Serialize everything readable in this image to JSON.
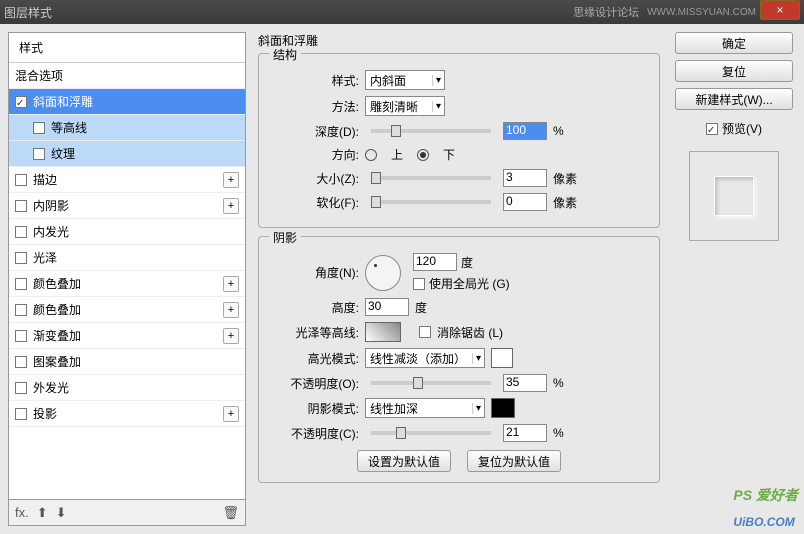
{
  "titlebar": {
    "title": "图层样式",
    "brand": "思缘设计论坛",
    "url": "WWW.MISSYUAN.COM",
    "close": "×"
  },
  "styles_list": {
    "header": "样式",
    "blend_options": "混合选项",
    "items": [
      {
        "label": "斜面和浮雕",
        "checked": true,
        "selected": true,
        "has_plus": false
      },
      {
        "label": "等高线",
        "checked": false,
        "sub": true
      },
      {
        "label": "纹理",
        "checked": false,
        "sub": true
      },
      {
        "label": "描边",
        "checked": false,
        "has_plus": true
      },
      {
        "label": "内阴影",
        "checked": false,
        "has_plus": true
      },
      {
        "label": "内发光",
        "checked": false
      },
      {
        "label": "光泽",
        "checked": false
      },
      {
        "label": "颜色叠加",
        "checked": false,
        "has_plus": true
      },
      {
        "label": "颜色叠加",
        "checked": false,
        "has_plus": true
      },
      {
        "label": "渐变叠加",
        "checked": false,
        "has_plus": true
      },
      {
        "label": "图案叠加",
        "checked": false
      },
      {
        "label": "外发光",
        "checked": false
      },
      {
        "label": "投影",
        "checked": false,
        "has_plus": true
      }
    ]
  },
  "bevel": {
    "section_title": "斜面和浮雕",
    "structure_title": "结构",
    "style_label": "样式:",
    "style_value": "内斜面",
    "method_label": "方法:",
    "method_value": "雕刻清晰",
    "depth_label": "深度(D):",
    "depth_value": "100",
    "percent": "%",
    "direction_label": "方向:",
    "dir_up": "上",
    "dir_down": "下",
    "size_label": "大小(Z):",
    "size_value": "3",
    "px": "像素",
    "soften_label": "软化(F):",
    "soften_value": "0"
  },
  "shadow": {
    "section_title": "阴影",
    "angle_label": "角度(N):",
    "angle_value": "120",
    "deg": "度",
    "global_light": "使用全局光 (G)",
    "altitude_label": "高度:",
    "altitude_value": "30",
    "gloss_label": "光泽等高线:",
    "antialias": "消除锯齿 (L)",
    "highlight_mode_label": "高光模式:",
    "highlight_mode_value": "线性减淡（添加）",
    "opacity_label": "不透明度(O):",
    "opacity_value": "35",
    "shadow_mode_label": "阴影模式:",
    "shadow_mode_value": "线性加深",
    "opacity2_label": "不透明度(C):",
    "opacity2_value": "21"
  },
  "buttons": {
    "ok": "确定",
    "reset": "复位",
    "new_style": "新建样式(W)...",
    "preview": "预览(V)",
    "set_default": "设置为默认值",
    "reset_default": "复位为默认值"
  },
  "watermark": {
    "ps": "PS 爱好者",
    "main": "UiBO.COM"
  }
}
